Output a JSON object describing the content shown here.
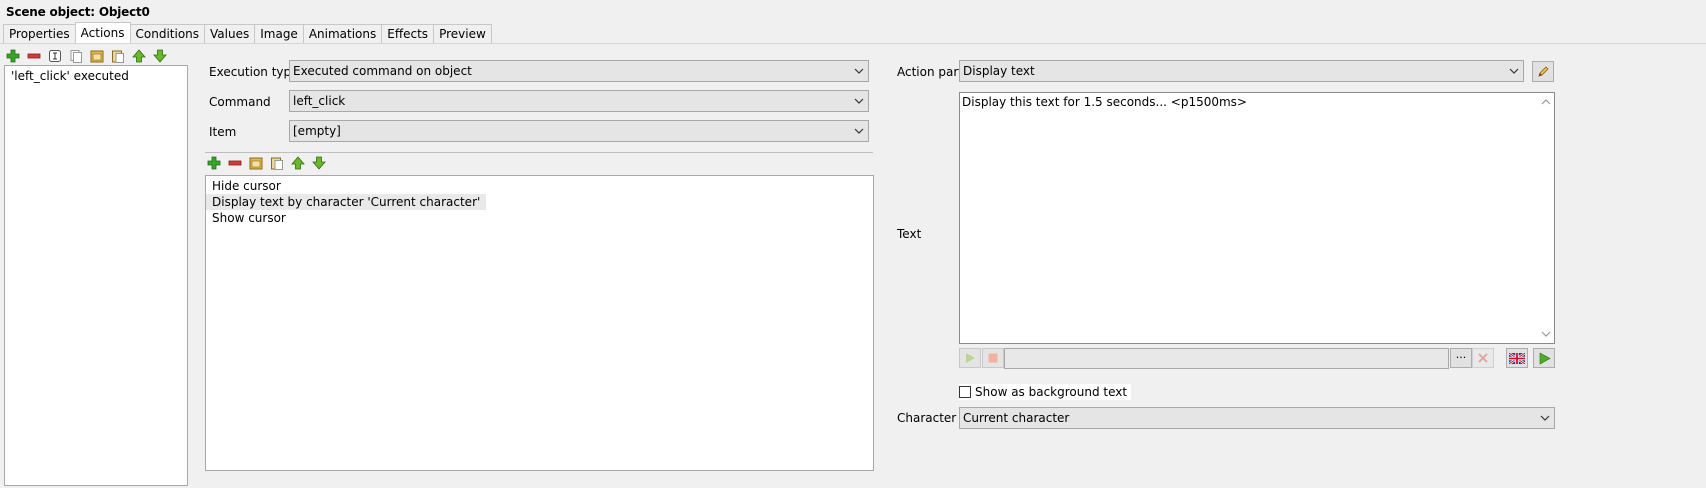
{
  "header": {
    "title": "Scene object: Object0"
  },
  "tabs": [
    {
      "label": "Properties"
    },
    {
      "label": "Actions"
    },
    {
      "label": "Conditions"
    },
    {
      "label": "Values"
    },
    {
      "label": "Image"
    },
    {
      "label": "Animations"
    },
    {
      "label": "Effects"
    },
    {
      "label": "Preview"
    }
  ],
  "active_tab": "Actions",
  "icons": {
    "add": "plus-icon",
    "remove": "minus-icon",
    "rename": "rename-icon",
    "copy": "copy-icon",
    "paste": "paste-icon",
    "move_up": "arrow-up-icon",
    "move_down": "arrow-down-icon"
  },
  "colors": {
    "plus": "#3aa32a",
    "minus": "#cf2a2a",
    "arrow": "#4fa61a",
    "folder": "#e0b84a"
  },
  "events_list": {
    "items": [
      {
        "label": "'left_click' executed"
      }
    ]
  },
  "event_form": {
    "execution_type": {
      "label": "Execution type",
      "value": "Executed command on object"
    },
    "command": {
      "label": "Command",
      "value": "left_click"
    },
    "item": {
      "label": "Item",
      "value": "[empty]"
    }
  },
  "action_list": {
    "items": [
      {
        "label": "Hide cursor"
      },
      {
        "label": "Display text by character 'Current character'"
      },
      {
        "label": "Show cursor"
      }
    ],
    "selected_index": 1
  },
  "action_part": {
    "label": "Action part",
    "value": "Display text"
  },
  "text_field": {
    "label": "Text",
    "value": "Display this text for 1.5 seconds... <p1500ms>"
  },
  "audio_bar": {
    "more_label": "···"
  },
  "background_text": {
    "label": "Show as background text",
    "checked": false
  },
  "character": {
    "label": "Character",
    "value": "Current character"
  }
}
